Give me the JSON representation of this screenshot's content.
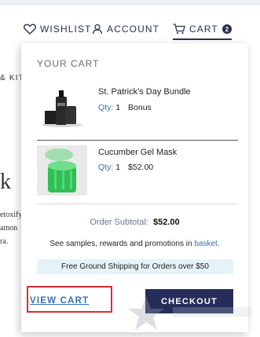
{
  "header": {
    "wishlist_label": "WISHLIST",
    "account_label": "ACCOUNT",
    "cart_label": "CART",
    "cart_count": "2"
  },
  "background": {
    "kits_text": "& KITS",
    "big_letter": "k",
    "line1": "etoxify",
    "line2": "amon",
    "line3": "ra."
  },
  "cart": {
    "title": "YOUR CART",
    "items": [
      {
        "name": "St. Patrick's Day Bundle",
        "qty_label": "Qty:",
        "qty": "1",
        "price": "Bonus"
      },
      {
        "name": "Cucumber Gel Mask",
        "qty_label": "Qty:",
        "qty": "1",
        "price": "$52.00"
      }
    ],
    "subtotal_label": "Order Subtotal:",
    "subtotal_value": "$52.00",
    "samples_text": "See samples, rewards and promotions in",
    "samples_link": "basket.",
    "shipping_banner": "Free Ground Shipping for Orders over $50",
    "view_cart_label": "VIEW CART",
    "checkout_label": "CHECKOUT"
  },
  "colors": {
    "navy": "#262d59",
    "link_blue": "#3b6fb6",
    "highlight_red": "#e02a2f",
    "banner_bg": "#e6f3f8"
  },
  "icons": [
    "heart-icon",
    "user-icon",
    "cart-icon",
    "star-watermark-icon"
  ]
}
